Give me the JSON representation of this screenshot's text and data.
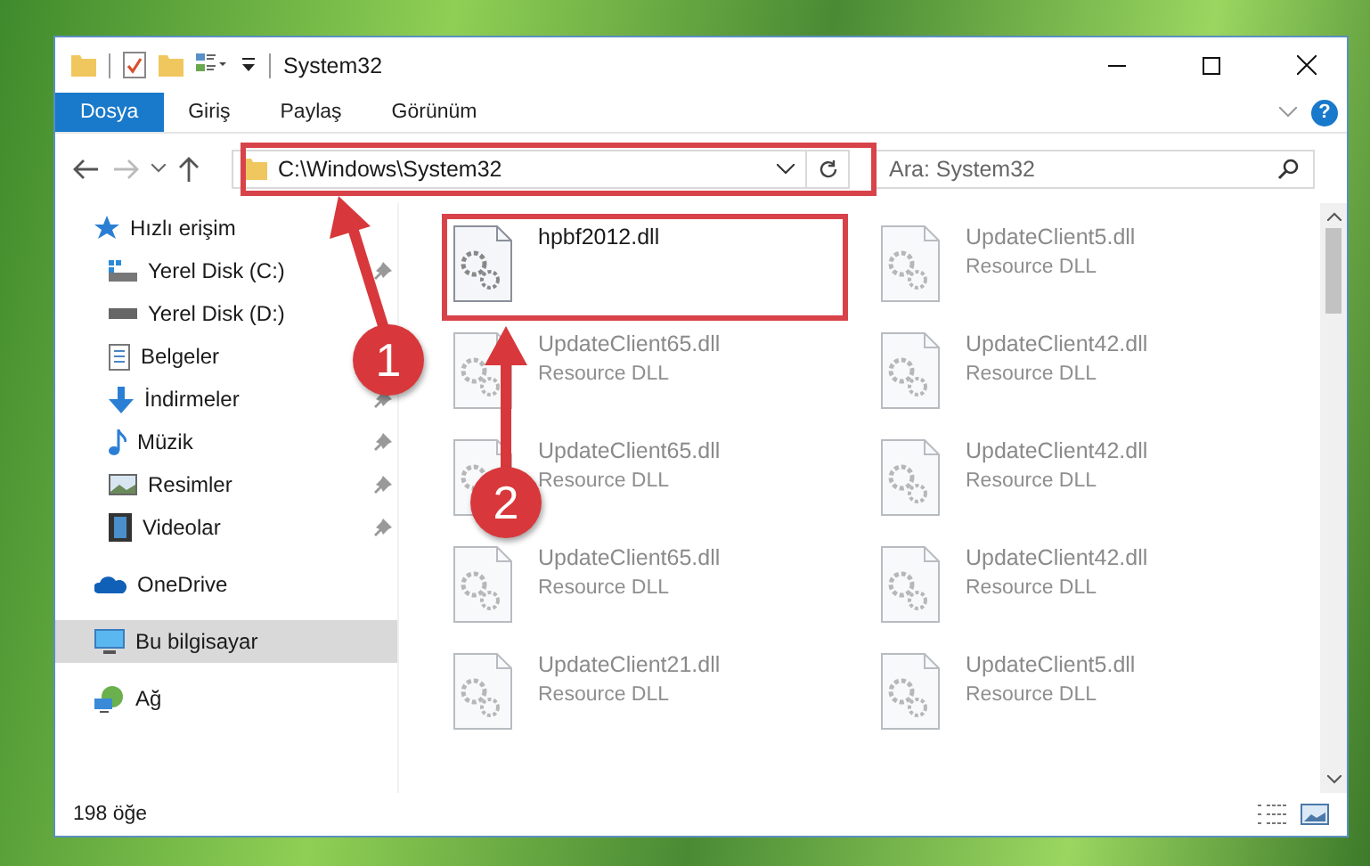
{
  "window": {
    "title": "System32"
  },
  "ribbon_tabs": [
    {
      "label": "Dosya",
      "selected": true
    },
    {
      "label": "Giriş",
      "selected": false
    },
    {
      "label": "Paylaş",
      "selected": false
    },
    {
      "label": "Görünüm",
      "selected": false
    }
  ],
  "help_button": "?",
  "address": {
    "path": "C:\\Windows\\System32"
  },
  "search": {
    "placeholder": "Ara: System32"
  },
  "sidebar": {
    "items": [
      {
        "label": "Hızlı erişim",
        "kind": "star",
        "selected": false,
        "children": [
          {
            "label": "Yerel Disk (C:)",
            "kind": "systemdrive",
            "pinned": true,
            "selected": false
          },
          {
            "label": "Yerel Disk (D:)",
            "kind": "drive",
            "pinned": false,
            "selected": false
          },
          {
            "label": "Belgeler",
            "kind": "documents",
            "pinned": false,
            "selected": false
          },
          {
            "label": "İndirmeler",
            "kind": "downloads",
            "pinned": true,
            "selected": false
          },
          {
            "label": "Müzik",
            "kind": "music",
            "pinned": true,
            "selected": false
          },
          {
            "label": "Resimler",
            "kind": "pictures",
            "pinned": true,
            "selected": false
          },
          {
            "label": "Videolar",
            "kind": "videos",
            "pinned": true,
            "selected": false
          }
        ]
      },
      {
        "label": "OneDrive",
        "kind": "cloud",
        "selected": false
      },
      {
        "label": "Bu bilgisayar",
        "kind": "computer",
        "selected": true
      },
      {
        "label": "Ağ",
        "kind": "network",
        "selected": false
      }
    ]
  },
  "files": [
    {
      "name": "hpbf2012.dll"
    },
    {
      "name": "UpdateClient5.dll",
      "type": "Resource DLL"
    },
    {
      "name": "UpdateClient65.dll",
      "type": "Resource DLL"
    },
    {
      "name": "UpdateClient42.dll",
      "type": "Resource DLL"
    },
    {
      "name": "UpdateClient65.dll",
      "type": "Resource DLL"
    },
    {
      "name": "UpdateClient42.dll",
      "type": "Resource DLL"
    },
    {
      "name": "UpdateClient65.dll",
      "type": "Resource DLL"
    },
    {
      "name": "UpdateClient42.dll",
      "type": "Resource DLL"
    },
    {
      "name": "UpdateClient21.dll",
      "type": "Resource DLL"
    },
    {
      "name": "UpdateClient5.dll",
      "type": "Resource DLL"
    }
  ],
  "status_bar": {
    "item_count": "198 öğe"
  },
  "annotations": [
    {
      "label": "1"
    },
    {
      "label": "2"
    }
  ]
}
